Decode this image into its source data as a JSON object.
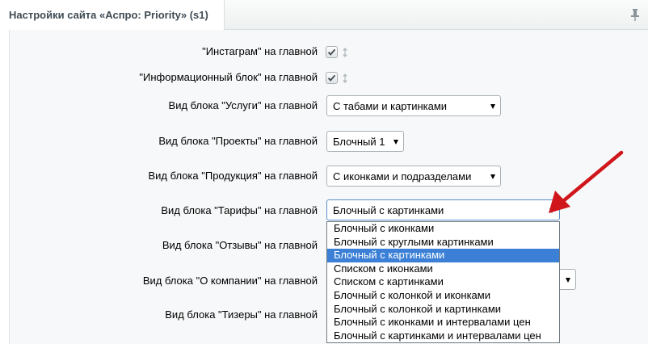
{
  "header": {
    "title": "Настройки сайта «Аспро: Priority» (s1)"
  },
  "rows": {
    "instagram": {
      "label": "\"Инстаграм\" на главной",
      "checked": true
    },
    "infoblock": {
      "label": "\"Информационный блок\" на главной",
      "checked": true
    },
    "services": {
      "label": "Вид блока \"Услуги\" на главной",
      "value": "С табами и картинками"
    },
    "projects": {
      "label": "Вид блока \"Проекты\" на главной",
      "value": "Блочный 1"
    },
    "products": {
      "label": "Вид блока \"Продукция\" на главной",
      "value": "С иконками и подразделами"
    },
    "tariffs": {
      "label": "Вид блока \"Тарифы\" на главной",
      "value": "Блочный с картинками"
    },
    "reviews": {
      "label": "Вид блока \"Отзывы\" на главной"
    },
    "company": {
      "label": "Вид блока \"О компании\" на главной"
    },
    "teasers": {
      "label": "Вид блока \"Тизеры\" на главной"
    }
  },
  "dropdown": {
    "selected_index": 2,
    "options": [
      "Блочный с иконками",
      "Блочный с круглыми картинками",
      "Блочный с картинками",
      "Списком с иконками",
      "Списком с картинками",
      "Блочный с колонкой и иконками",
      "Блочный с колонкой и картинками",
      "Блочный с иконками и интервалами цен",
      "Блочный с картинками и интервалами цен"
    ]
  },
  "colors": {
    "selected_option": "#3b80d6",
    "annotation_arrow": "#d0161b",
    "panel_bg": "#f7f8f9"
  }
}
